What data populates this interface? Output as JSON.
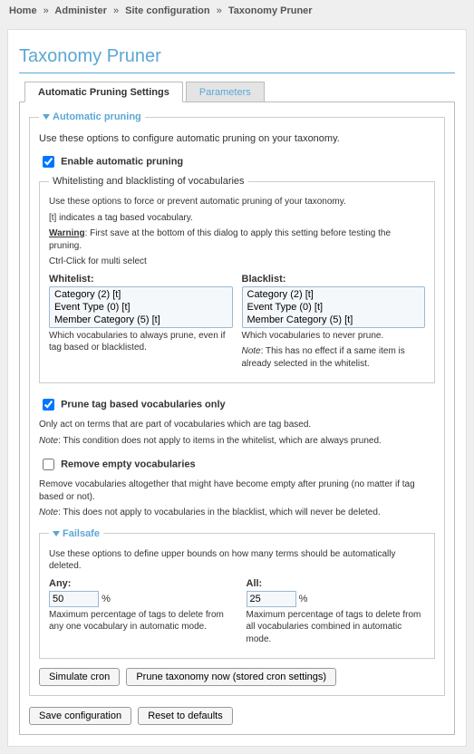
{
  "breadcrumb": {
    "home": "Home",
    "administer": "Administer",
    "siteconfig": "Site configuration",
    "current": "Taxonomy Pruner"
  },
  "title": "Taxonomy Pruner",
  "tabs": {
    "auto": "Automatic Pruning Settings",
    "params": "Parameters"
  },
  "fs_auto": {
    "legend": "Automatic pruning",
    "intro": "Use these options to configure automatic pruning on your taxonomy.",
    "enable_label": "Enable automatic pruning"
  },
  "fs_wlbl": {
    "legend": "Whitelisting and blacklisting of vocabularies",
    "line1": "Use these options to force or prevent automatic pruning of your taxonomy.",
    "line2": "[t] indicates a tag based vocabulary.",
    "warn_label": "Warning",
    "warn_text": ": First save at the bottom of this dialog to apply this setting before testing the pruning.",
    "ctrl": "Ctrl-Click for multi select",
    "whitelist_label": "Whitelist:",
    "blacklist_label": "Blacklist:",
    "options": [
      "Category (2) [t]",
      "Event Type (0) [t]",
      "Member Category (5) [t]"
    ],
    "wl_help": "Which vocabularies to always prune, even if tag based or blacklisted.",
    "bl_help1": "Which vocabularies to never prune.",
    "bl_help2_label": "Note",
    "bl_help2_text": ": This has no effect if a same item is already selected in the whitelist."
  },
  "prune_tag": {
    "label": "Prune tag based vocabularies only",
    "desc1": "Only act on terms that are part of vocabularies which are tag based.",
    "note_label": "Note",
    "note_text": ": This condition does not apply to items in the whitelist, which are always pruned."
  },
  "remove_empty": {
    "label": "Remove empty vocabularies",
    "desc1": "Remove vocabularies altogether that might have become empty after pruning (no matter if tag based or not).",
    "note_label": "Note",
    "note_text": ": This does not apply to vocabularies in the blacklist, which will never be deleted."
  },
  "failsafe": {
    "legend": "Failsafe",
    "intro": "Use these options to define upper bounds on how many terms should be automatically deleted.",
    "any_label": "Any:",
    "any_value": "50",
    "any_desc": "Maximum percentage of tags to delete from any one vocabulary in automatic mode.",
    "all_label": "All:",
    "all_value": "25",
    "all_desc": "Maximum percentage of tags to delete from all vocabularies combined in automatic mode.",
    "pct": "%"
  },
  "buttons": {
    "simulate": "Simulate cron",
    "prune_now": "Prune taxonomy now (stored cron settings)",
    "save": "Save configuration",
    "reset": "Reset to defaults"
  }
}
